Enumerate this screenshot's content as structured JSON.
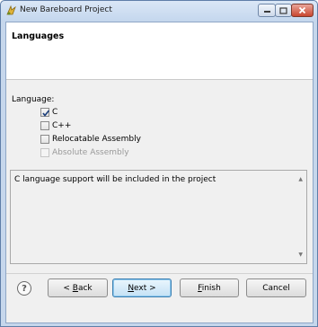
{
  "window": {
    "title": "New Bareboard Project"
  },
  "page": {
    "title": "Languages"
  },
  "language_group": {
    "label": "Language:",
    "options": [
      {
        "label": "C",
        "checked": true,
        "enabled": true
      },
      {
        "label": "C++",
        "checked": false,
        "enabled": true
      },
      {
        "label": "Relocatable Assembly",
        "checked": false,
        "enabled": true
      },
      {
        "label": "Absolute Assembly",
        "checked": false,
        "enabled": false
      }
    ]
  },
  "description": {
    "text": "C language support will be included in the project"
  },
  "buttons": {
    "help": "?",
    "back_pre": "< ",
    "back_accel": "B",
    "back_post": "ack",
    "next_accel": "N",
    "next_post": "ext >",
    "finish_accel": "F",
    "finish_post": "inish",
    "cancel": "Cancel"
  },
  "colors": {
    "title_bar": "#c5d7ee",
    "close_button": "#c9462f",
    "dialog_bg": "#f0f0f0"
  }
}
